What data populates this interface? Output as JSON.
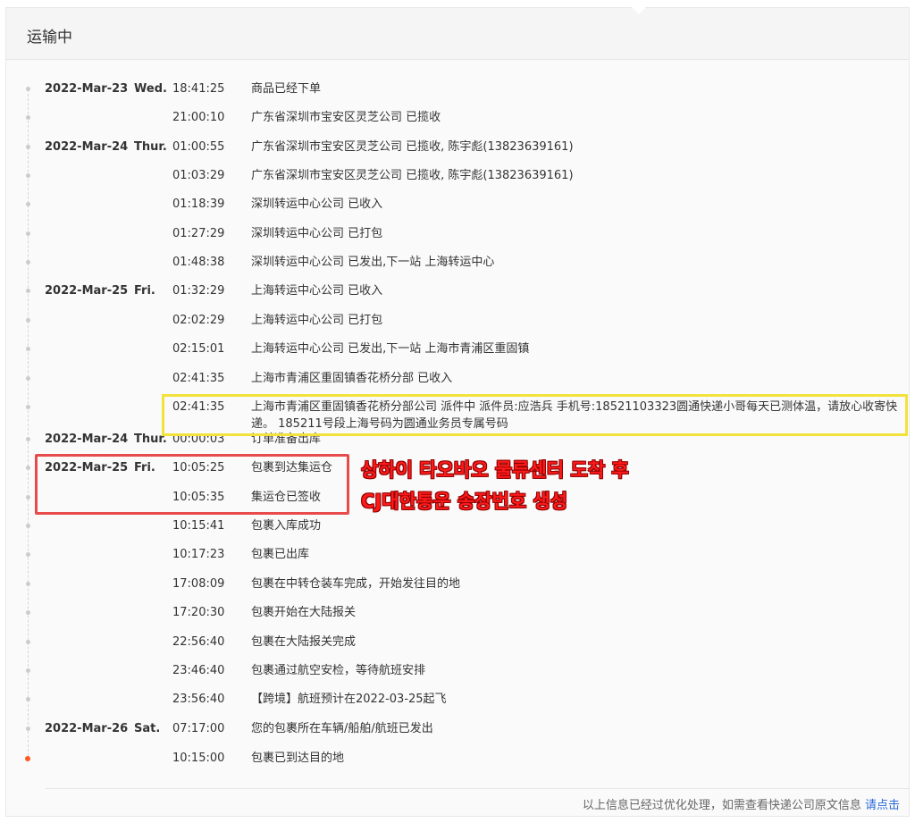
{
  "header": {
    "title": "运输中"
  },
  "events": [
    {
      "date": "2022-Mar-23",
      "weekday": "Wed.",
      "time": "18:41:25",
      "desc": "商品已经下单"
    },
    {
      "date": "",
      "weekday": "",
      "time": "21:00:10",
      "desc": "广东省深圳市宝安区灵芝公司 已揽收"
    },
    {
      "date": "2022-Mar-24",
      "weekday": "Thur.",
      "time": "01:00:55",
      "desc": "广东省深圳市宝安区灵芝公司 已揽收, 陈宇彪(13823639161)"
    },
    {
      "date": "",
      "weekday": "",
      "time": "01:03:29",
      "desc": "广东省深圳市宝安区灵芝公司 已揽收, 陈宇彪(13823639161)"
    },
    {
      "date": "",
      "weekday": "",
      "time": "01:18:39",
      "desc": "深圳转运中心公司 已收入"
    },
    {
      "date": "",
      "weekday": "",
      "time": "01:27:29",
      "desc": "深圳转运中心公司 已打包"
    },
    {
      "date": "",
      "weekday": "",
      "time": "01:48:38",
      "desc": "深圳转运中心公司 已发出,下一站 上海转运中心"
    },
    {
      "date": "2022-Mar-25",
      "weekday": "Fri.",
      "time": "01:32:29",
      "desc": "上海转运中心公司 已收入"
    },
    {
      "date": "",
      "weekday": "",
      "time": "02:02:29",
      "desc": "上海转运中心公司 已打包"
    },
    {
      "date": "",
      "weekday": "",
      "time": "02:15:01",
      "desc": "上海转运中心公司 已发出,下一站 上海市青浦区重固镇"
    },
    {
      "date": "",
      "weekday": "",
      "time": "02:41:35",
      "desc": "上海市青浦区重固镇香花桥分部 已收入"
    },
    {
      "date": "",
      "weekday": "",
      "time": "02:41:35",
      "desc": "上海市青浦区重固镇香花桥分部公司 派件中 派件员:应浩兵 手机号:18521103323圆通快递小哥每天已测体温，请放心收寄快递。 185211号段上海号码为圆通业务员专属号码"
    },
    {
      "date": "2022-Mar-24",
      "weekday": "Thur.",
      "time": "00:00:03",
      "desc": "订单准备出库"
    },
    {
      "date": "2022-Mar-25",
      "weekday": "Fri.",
      "time": "10:05:25",
      "desc": "包裹到达集运仓"
    },
    {
      "date": "",
      "weekday": "",
      "time": "10:05:35",
      "desc": "集运仓已签收"
    },
    {
      "date": "",
      "weekday": "",
      "time": "10:15:41",
      "desc": "包裹入库成功"
    },
    {
      "date": "",
      "weekday": "",
      "time": "10:17:23",
      "desc": "包裹已出库"
    },
    {
      "date": "",
      "weekday": "",
      "time": "17:08:09",
      "desc": "包裹在中转仓装车完成，开始发往目的地"
    },
    {
      "date": "",
      "weekday": "",
      "time": "17:20:30",
      "desc": "包裹开始在大陆报关"
    },
    {
      "date": "",
      "weekday": "",
      "time": "22:56:40",
      "desc": "包裹在大陆报关完成"
    },
    {
      "date": "",
      "weekday": "",
      "time": "23:46:40",
      "desc": "包裹通过航空安检，等待航班安排"
    },
    {
      "date": "",
      "weekday": "",
      "time": "23:56:40",
      "desc": "【跨境】航班预计在2022-03-25起飞"
    },
    {
      "date": "2022-Mar-26",
      "weekday": "Sat.",
      "time": "07:17:00",
      "desc": "您的包裹所在车辆/船舶/航班已发出"
    },
    {
      "date": "",
      "weekday": "",
      "time": "10:15:00",
      "desc": "包裹已到达目的地"
    }
  ],
  "footer": {
    "text": "以上信息已经过优化处理，如需查看快递公司原文信息",
    "link": "请点击"
  },
  "annotations": {
    "line1": "상하이 타오바오 물류센터 도착 후",
    "line2": "CJ대한통운 송장번호 생성"
  },
  "colors": {
    "accent_dot": "#ff5a1f",
    "highlight_yellow": "#f2e23a",
    "highlight_red": "#e84b4b",
    "annotation_text": "#ff1a1a",
    "link": "#2a6ad8"
  }
}
